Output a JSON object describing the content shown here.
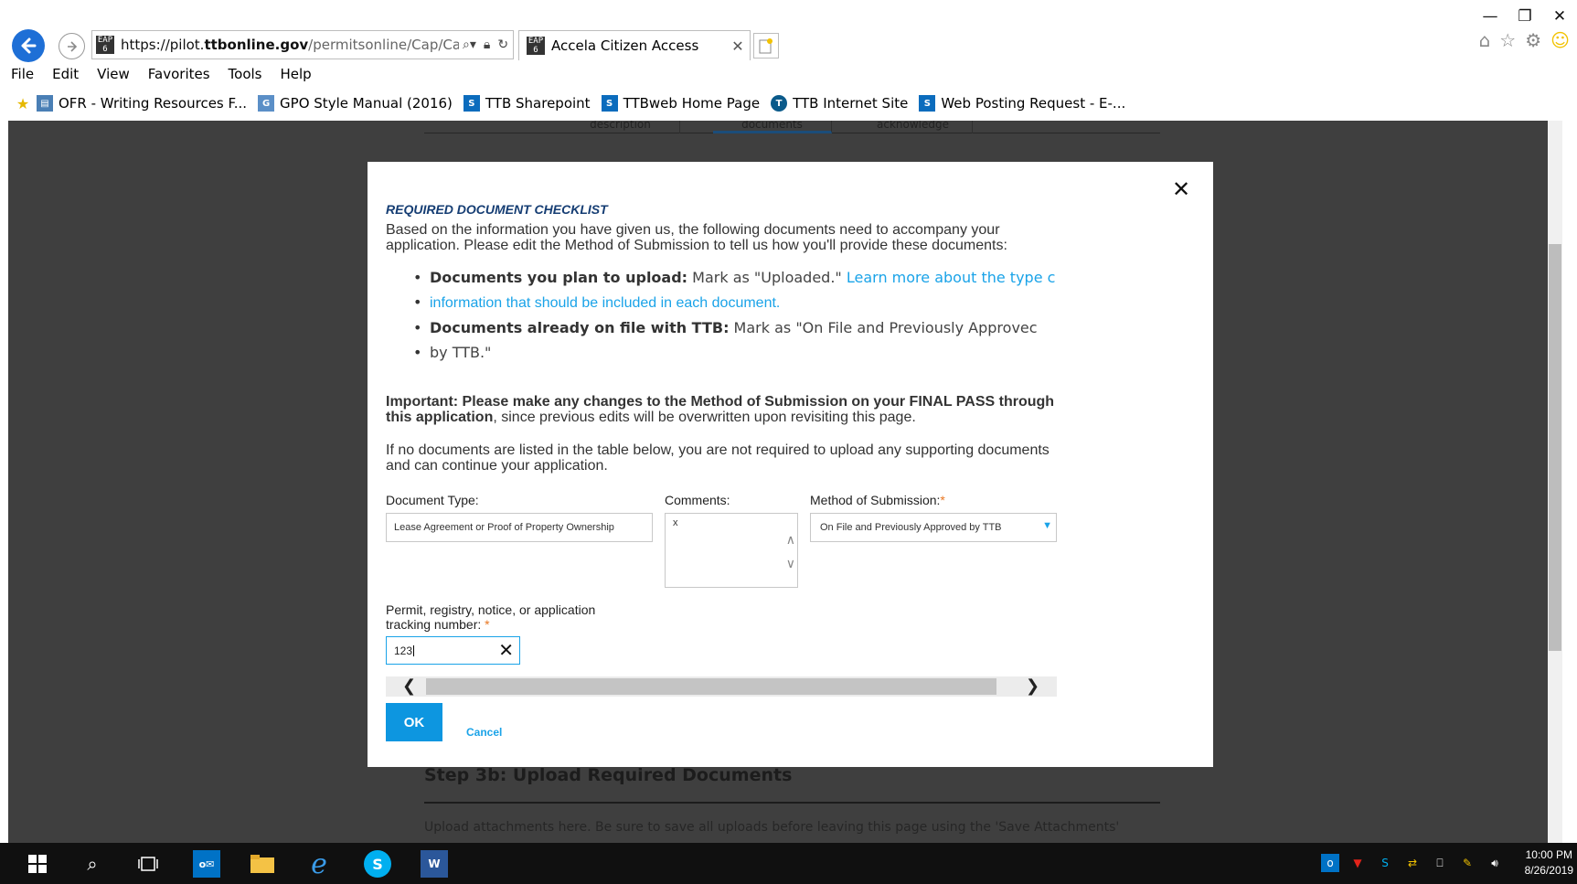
{
  "browser": {
    "window_controls": {
      "minimize": "—",
      "restore": "❐",
      "close": "✕"
    },
    "address": {
      "scheme": "https://pilot.",
      "domain": "ttbonline.gov",
      "path": "/permitsonline/Cap/Cap",
      "favicon": "EAP 6"
    },
    "tab": {
      "title": "Accela Citizen Access",
      "favicon": "EAP 6"
    },
    "menu": [
      "File",
      "Edit",
      "View",
      "Favorites",
      "Tools",
      "Help"
    ],
    "favorites": [
      {
        "label": "OFR - Writing Resources F...",
        "icon": "document-icon"
      },
      {
        "label": "GPO Style Manual (2016)",
        "icon": "gpo-icon"
      },
      {
        "label": "TTB Sharepoint",
        "icon": "sharepoint-icon"
      },
      {
        "label": "TTBweb Home Page",
        "icon": "sharepoint-icon"
      },
      {
        "label": "TTB Internet Site",
        "icon": "ttb-seal-icon"
      },
      {
        "label": "Web Posting Request - E-...",
        "icon": "sharepoint-icon"
      }
    ],
    "colors": {
      "back_button": "#1e6fd6",
      "link": "#1aa3e8"
    }
  },
  "underlay": {
    "tabs": [
      "description",
      "documents",
      "acknowledge"
    ],
    "step_title": "Step 3b: Upload Required Documents",
    "note": "Upload attachments here. Be sure to save all uploads before leaving this page using the 'Save Attachments'"
  },
  "modal": {
    "close_label": "✕",
    "title": "REQUIRED DOCUMENT CHECKLIST",
    "intro": "Based on the information you have given us, the following documents need to accompany your application. Please edit the Method of Submission to tell us how you'll provide these documents:",
    "bullets": [
      {
        "bold": "Documents you plan to upload:",
        "text": " Mark as \"Uploaded.\" ",
        "link": "Learn more about the type c",
        "cont_link": "information that should be included in each document."
      },
      {
        "bold": "Documents already on file with TTB:",
        "text": " Mark as \"On File and Previously Approvec",
        "cont": "by TTB.\""
      }
    ],
    "important_bold": "Important: Please make any changes to the Method of Submission on your FINAL PASS through this application",
    "important_rest": ", since previous edits will be overwritten upon revisiting this page.",
    "no_docs_text": "If no documents are listed in the table below, you are not required to upload any supporting documents and can continue your application.",
    "fields": {
      "document_type_label": "Document Type:",
      "document_type_value": "Lease Agreement or Proof of Property Ownership",
      "comments_label": "Comments:",
      "comments_value": "x",
      "method_label": "Method of Submission:",
      "method_value": "On File and Previously Approved by TTB",
      "tracking_label_1": "Permit, registry, notice, or application",
      "tracking_label_2": "tracking number:",
      "tracking_value": "123",
      "required_star": "*"
    },
    "ok_label": "OK",
    "cancel_label": "Cancel",
    "colors": {
      "title": "#153d73",
      "ok_button": "#0d96e0",
      "required": "#e87722"
    }
  },
  "taskbar": {
    "time": "10:00 PM",
    "date": "8/26/2019"
  }
}
